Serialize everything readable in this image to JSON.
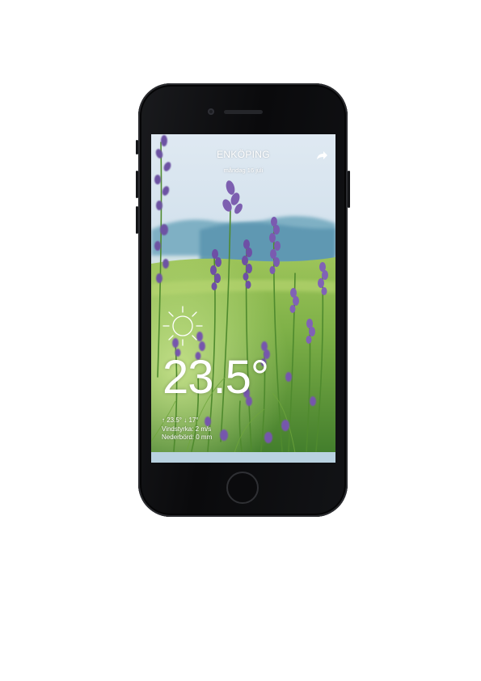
{
  "weather": {
    "city": "ENKÖPING",
    "date": "måndag 16 juli",
    "temperature": "23.5°",
    "high_arrow": "↑",
    "high": "23.5°",
    "low_arrow": "↓",
    "low": "17°",
    "wind": "Vindstyrka: 2 m/s",
    "precipitation": "Nederbörd: 0 mm",
    "condition_icon": "sun-icon",
    "share_icon": "share-icon"
  }
}
